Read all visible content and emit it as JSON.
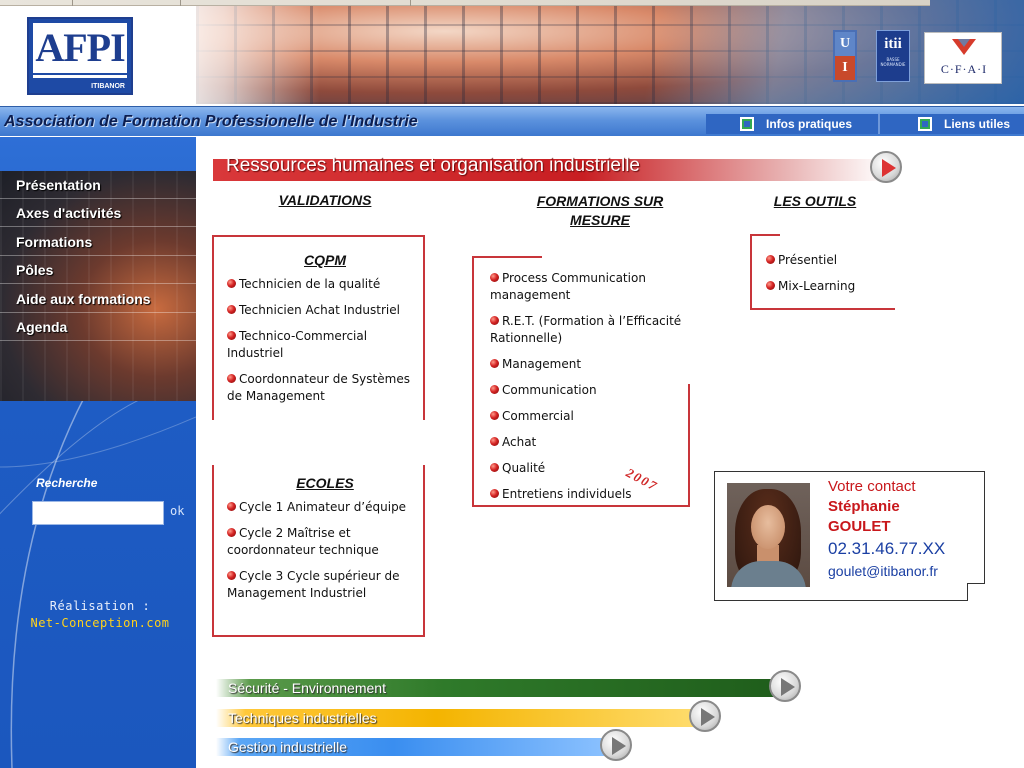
{
  "header": {
    "logo_afpi": {
      "main": "AFPI",
      "sub": "ITIBANOR"
    },
    "logo_uimm": {
      "top": "U",
      "bottom": "I"
    },
    "logo_itii": {
      "main": "itii",
      "sub": "BASSE NORMANDIE"
    },
    "logo_cfai": "C·F·A·I"
  },
  "titlebar": {
    "title": "Association de Formation Professionelle de l'Industrie",
    "links": [
      {
        "label": "Infos pratiques"
      },
      {
        "label": "Liens utiles"
      }
    ]
  },
  "sidebar": {
    "menu": [
      {
        "label": "Présentation"
      },
      {
        "label": "Axes d'activités"
      },
      {
        "label": "Formations"
      },
      {
        "label": "Pôles"
      },
      {
        "label": "Aide aux formations"
      },
      {
        "label": "Agenda"
      }
    ],
    "search_label": "Recherche",
    "search_value": "",
    "search_button": "ok",
    "credit_label": "Réalisation :",
    "credit_name": "Net-Conception.com"
  },
  "main": {
    "banner_title": "Ressources humaines et organisation industrielle",
    "columns": {
      "validations": "VALIDATIONS",
      "formations_sur_mesure": "FORMATIONS SUR MESURE",
      "les_outils": "LES OUTILS"
    },
    "cqpm": {
      "title": "CQPM",
      "items": [
        "Technicien de la qualité",
        "Technicien Achat Industriel",
        "Technico-Commercial Industriel",
        "Coordonnateur de Systèmes de Management"
      ]
    },
    "ecoles": {
      "title": "ECOLES",
      "items": [
        "Cycle 1 Animateur d’équipe",
        "Cycle 2 Maîtrise et coordonnateur technique",
        "Cycle 3 Cycle supérieur de Management Industriel"
      ]
    },
    "formations": {
      "items": [
        "Process Communication management",
        "R.E.T. (Formation à l’Efficacité Rationnelle)",
        "Management",
        "Communication",
        "Commercial",
        "Achat",
        "Qualité",
        "Entretiens individuels"
      ],
      "year_stamp": "2007"
    },
    "outils": {
      "items": [
        "Présentiel",
        "Mix-Learning"
      ]
    },
    "contact": {
      "label": "Votre contact",
      "first_name": "Stéphanie",
      "last_name": "GOULET",
      "phone": "02.31.46.77.XX",
      "email": "goulet@itibanor.fr"
    }
  },
  "bottom_banners": [
    {
      "label": "Sécurité - Environnement",
      "color": "#2f7a2a"
    },
    {
      "label": "Techniques industrielles",
      "color": "#f4b400"
    },
    {
      "label": "Gestion industrielle",
      "color": "#3a8ef0"
    }
  ],
  "colors": {
    "accent_red": "#c8353a",
    "sidebar_blue": "#1e5cc4",
    "contact_red": "#c8171b",
    "contact_blue": "#1a3fa3"
  }
}
